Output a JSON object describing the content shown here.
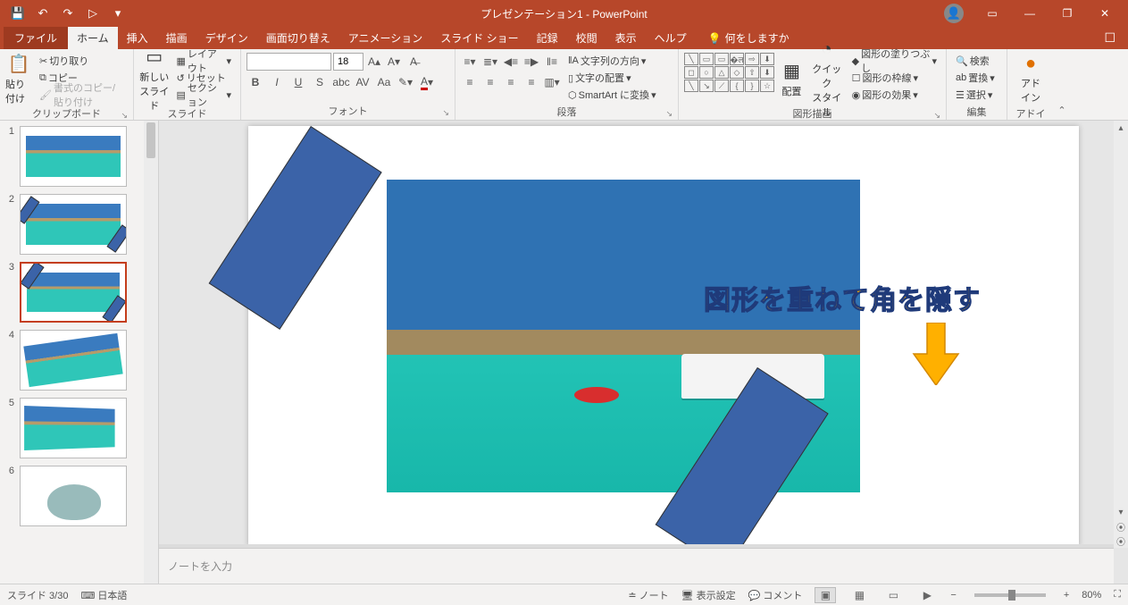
{
  "title": "プレゼンテーション1 - PowerPoint",
  "qat": {
    "save": "💾",
    "undo": "↶",
    "redo": "↷",
    "start": "▷",
    "more": "▾"
  },
  "win": {
    "ribbon": "▭",
    "min": "—",
    "max": "❐",
    "close": "✕"
  },
  "tabs": {
    "file": "ファイル",
    "items": [
      "ホーム",
      "挿入",
      "描画",
      "デザイン",
      "画面切り替え",
      "アニメーション",
      "スライド ショー",
      "記録",
      "校閲",
      "表示",
      "ヘルプ"
    ],
    "active": "ホーム",
    "tellme_icon": "💡",
    "tellme": "何をしますか"
  },
  "ribbon": {
    "clipboard": {
      "paste": "貼り付け",
      "cut": "切り取り",
      "copy": "コピー",
      "format": "書式のコピー/貼り付け",
      "label": "クリップボード"
    },
    "slides": {
      "new": "新しい\nスライド",
      "layout": "レイアウト",
      "reset": "リセット",
      "section": "セクション",
      "label": "スライド"
    },
    "font": {
      "size": "18",
      "label": "フォント"
    },
    "paragraph": {
      "direction": "文字列の方向",
      "align": "文字の配置",
      "smartart": "SmartArt に変換",
      "label": "段落"
    },
    "drawing": {
      "arrange": "配置",
      "quick": "クイック\nスタイル",
      "fill": "図形の塗りつぶし",
      "outline": "図形の枠線",
      "effects": "図形の効果",
      "label": "図形描画"
    },
    "editing": {
      "find": "検索",
      "replace": "置換",
      "select": "選択",
      "label": "編集"
    },
    "addins": {
      "btn": "アド\nイン",
      "label": "アドイン"
    }
  },
  "thumbs": [
    "1",
    "2",
    "3",
    "4",
    "5",
    "6"
  ],
  "selected_thumb": 3,
  "annotation": "図形を重ねて角を隠す",
  "notes_placeholder": "ノートを入力",
  "status": {
    "slide": "スライド 3/30",
    "lang": "日本語",
    "notes": "ノート",
    "display": "表示設定",
    "comments": "コメント",
    "zoom": "80%"
  }
}
